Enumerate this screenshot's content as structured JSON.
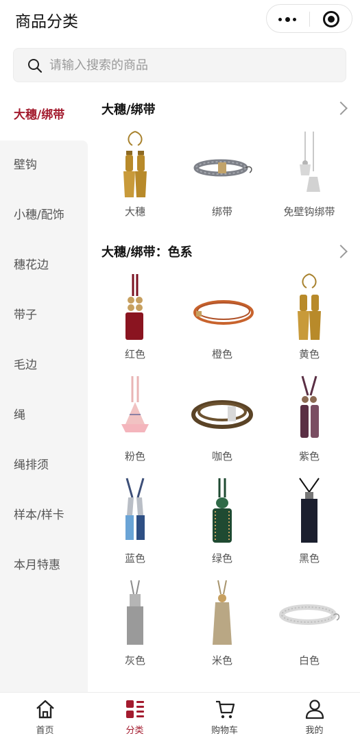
{
  "header": {
    "title": "商品分类"
  },
  "search": {
    "placeholder": "请输入搜索的商品"
  },
  "sidebar": {
    "items": [
      {
        "label": "大穗/绑带"
      },
      {
        "label": "壁钩"
      },
      {
        "label": "小穗/配饰"
      },
      {
        "label": "穗花边"
      },
      {
        "label": "带子"
      },
      {
        "label": "毛边"
      },
      {
        "label": "绳"
      },
      {
        "label": "绳排须"
      },
      {
        "label": "样本/样卡"
      },
      {
        "label": "本月特惠"
      }
    ]
  },
  "sections": [
    {
      "title": "大穗/绑带",
      "products": [
        {
          "label": "大穗",
          "icon": "gold-tassel"
        },
        {
          "label": "绑带",
          "icon": "grey-rope-tieback"
        },
        {
          "label": "免壁钩绑带",
          "icon": "silver-tassel-tieback"
        }
      ]
    },
    {
      "title": "大穗/绑带：色系",
      "products": [
        {
          "label": "红色",
          "icon": "red-tassel",
          "color": "#8a1420"
        },
        {
          "label": "橙色",
          "icon": "orange-rope",
          "color": "#c8632d"
        },
        {
          "label": "黄色",
          "icon": "yellow-tassel",
          "color": "#b88a2a"
        },
        {
          "label": "粉色",
          "icon": "pink-tassel",
          "color": "#e9a8a8"
        },
        {
          "label": "咖色",
          "icon": "brown-rope",
          "color": "#5a4326"
        },
        {
          "label": "紫色",
          "icon": "purple-tassel",
          "color": "#5a2f44"
        },
        {
          "label": "蓝色",
          "icon": "blue-tassel",
          "color": "#4a82b6"
        },
        {
          "label": "绿色",
          "icon": "green-tassel",
          "color": "#1f4a32"
        },
        {
          "label": "黑色",
          "icon": "black-tassel",
          "color": "#1b1f2e"
        },
        {
          "label": "灰色",
          "icon": "grey-tassel",
          "color": "#9a9a9a"
        },
        {
          "label": "米色",
          "icon": "beige-tassel",
          "color": "#b9a784"
        },
        {
          "label": "白色",
          "icon": "white-rope",
          "color": "#e6e6e6"
        }
      ]
    }
  ],
  "tabbar": {
    "tabs": [
      {
        "label": "首页",
        "icon": "home-icon"
      },
      {
        "label": "分类",
        "icon": "category-icon"
      },
      {
        "label": "购物车",
        "icon": "cart-icon"
      },
      {
        "label": "我的",
        "icon": "user-icon"
      }
    ]
  },
  "colors": {
    "accent": "#a31b2e",
    "sidebar_bg": "#f5f5f5"
  }
}
